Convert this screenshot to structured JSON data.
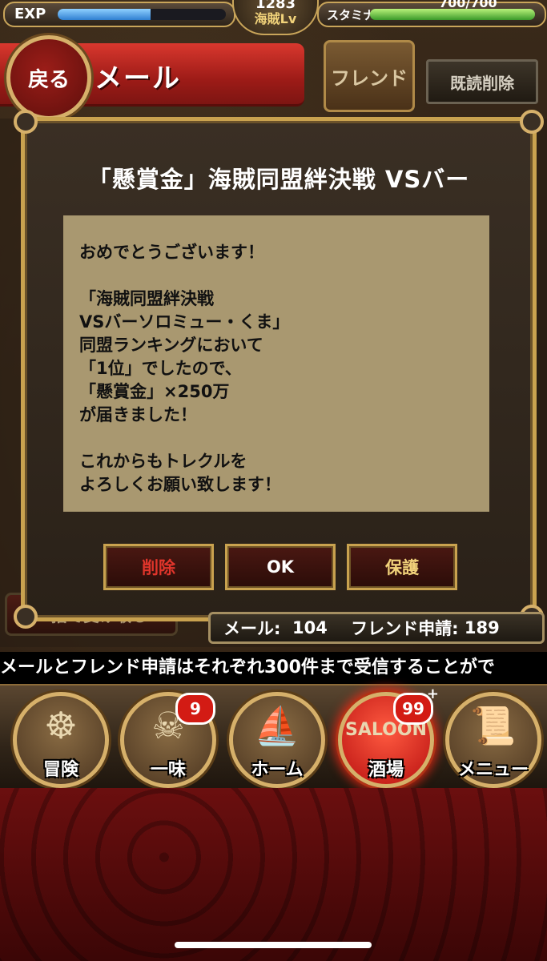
{
  "status": {
    "exp_label": "EXP",
    "exp_progress": 0.55,
    "level": "1283",
    "level_label": "海賊Lv",
    "stamina_label": "スタミナ",
    "stamina_value": "700/700",
    "stamina_progress": 1.0
  },
  "header": {
    "back_label": "戻る",
    "title": "メール",
    "friend_label": "フレンド",
    "read_delete_label": "既読削除"
  },
  "modal": {
    "title": "「懸賞金」海賊同盟絆決戦 VSバー",
    "body": "おめでとうございます！\n\n「海賊同盟絆決戦\nVSバーソロミュー・くま」\n同盟ランキングにおいて\n「1位」でしたので、\n「懸賞金」×250万\nが届きました！\n\nこれからもトレクルを\nよろしくお願い致します！",
    "buttons": {
      "delete": "削除",
      "ok": "OK",
      "protect": "保護"
    }
  },
  "receive_all_label": "一括で受け取る",
  "counter": {
    "mail_label": "メール:",
    "mail_count": "104",
    "friend_label": "フレンド申請:",
    "friend_count": "189"
  },
  "ticker": "メールとフレンド申請はそれぞれ300件まで受信することがで",
  "nav": [
    {
      "label": "冒険",
      "icon": "ship-wheel-icon"
    },
    {
      "label": "一味",
      "icon": "jolly-roger-icon",
      "badge": "9"
    },
    {
      "label": "ホーム",
      "icon": "ship-icon"
    },
    {
      "label": "酒場",
      "icon": "saloon-icon",
      "badge": "99",
      "badge_plus": "+"
    },
    {
      "label": "メニュー",
      "icon": "menu-scroll-icon"
    }
  ],
  "colors": {
    "accent_gold": "#c9a24f",
    "header_red": "#c62a22",
    "delete_text": "#e0352b",
    "ok_text": "#ffffff",
    "protect_text": "#f1d27a"
  }
}
